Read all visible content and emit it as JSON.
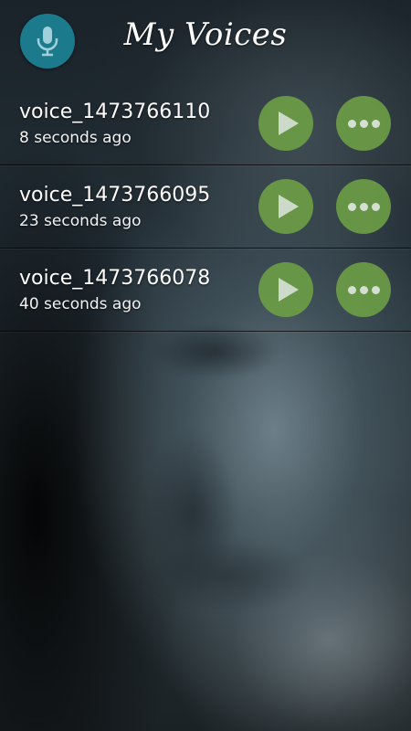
{
  "header": {
    "title": "My Voices",
    "mic_icon": "microphone-icon"
  },
  "colors": {
    "accent": "#1b7b8c",
    "action_button": "#6ea046"
  },
  "recordings": [
    {
      "name": "voice_1473766110",
      "time": "8 seconds ago"
    },
    {
      "name": "voice_1473766095",
      "time": "23 seconds ago"
    },
    {
      "name": "voice_1473766078",
      "time": "40 seconds ago"
    }
  ],
  "icons": {
    "play": "play-icon",
    "more": "more-options-icon"
  }
}
